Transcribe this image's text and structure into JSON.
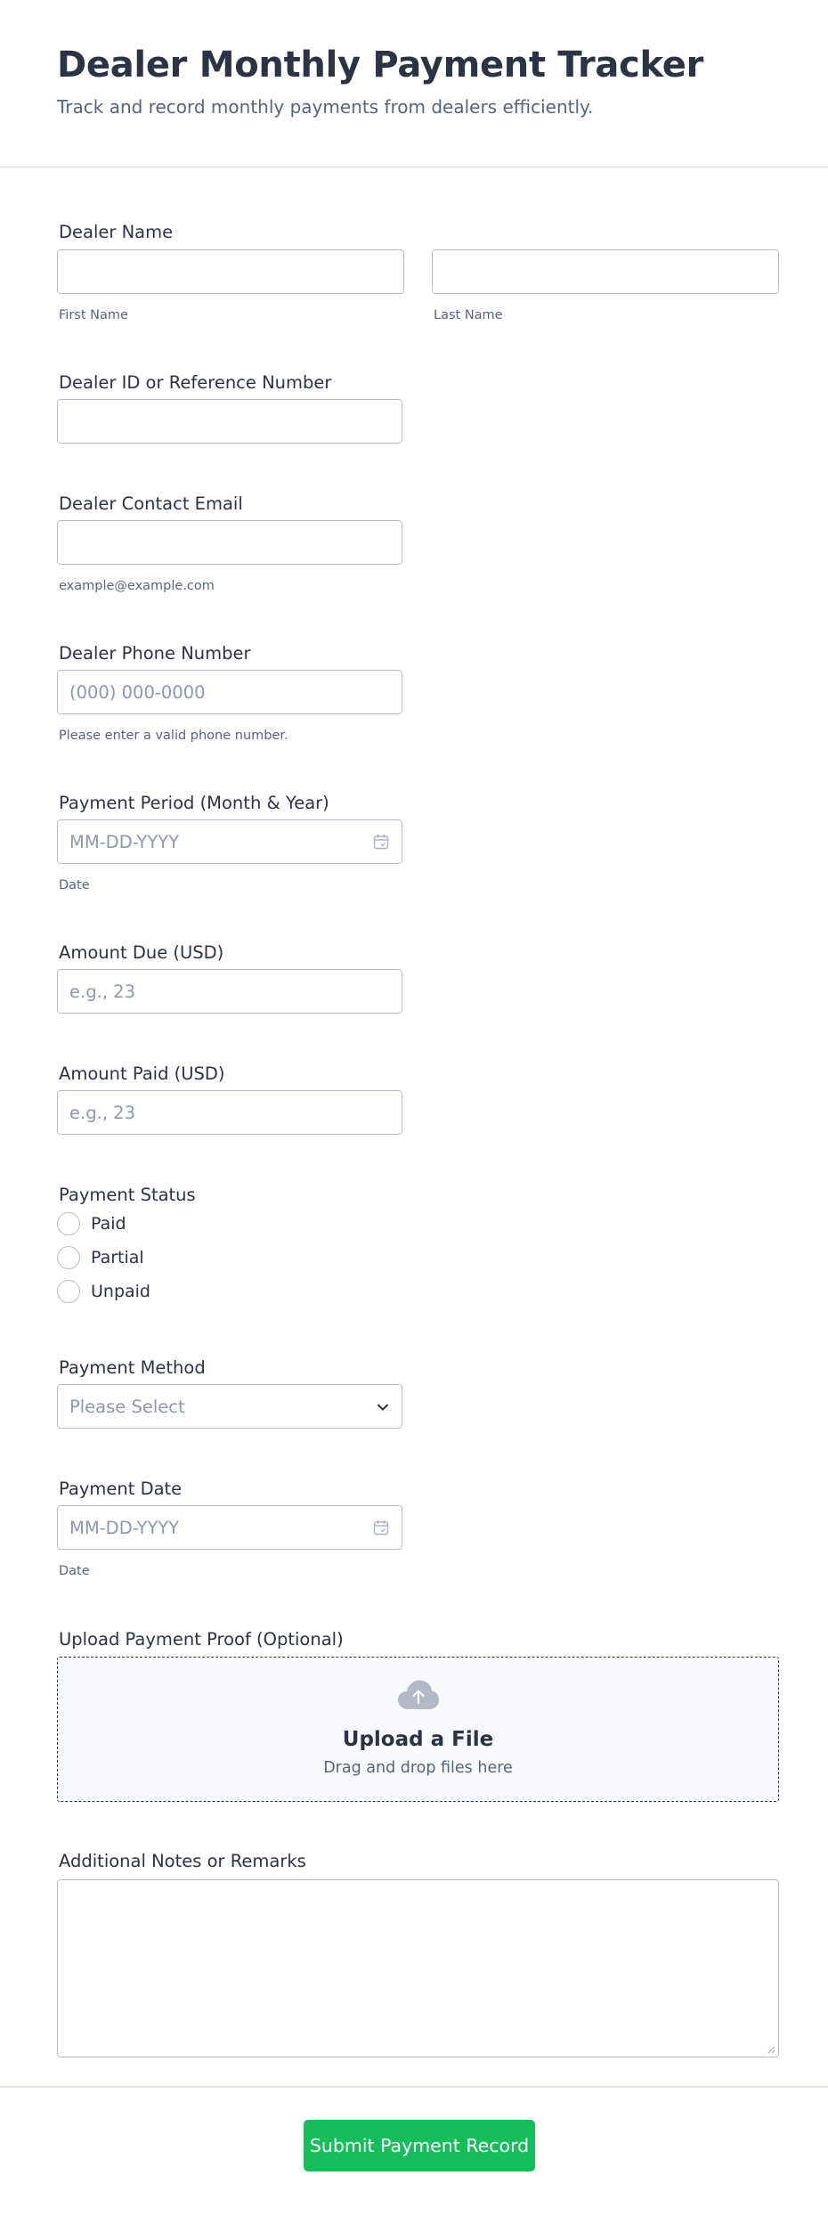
{
  "header": {
    "title": "Dealer Monthly Payment Tracker",
    "subtitle": "Track and record monthly payments from dealers efficiently."
  },
  "dealer_name": {
    "label": "Dealer Name",
    "first_sublabel": "First Name",
    "last_sublabel": "Last Name"
  },
  "dealer_id": {
    "label": "Dealer ID or Reference Number"
  },
  "email": {
    "label": "Dealer Contact Email",
    "sublabel": "example@example.com"
  },
  "phone": {
    "label": "Dealer Phone Number",
    "placeholder": "(000) 000-0000",
    "sublabel": "Please enter a valid phone number."
  },
  "payment_period": {
    "label": "Payment Period (Month & Year)",
    "placeholder": "MM-DD-YYYY",
    "sublabel": "Date",
    "icon": "calendar-icon"
  },
  "amount_due": {
    "label": "Amount Due (USD)",
    "placeholder": "e.g., 23"
  },
  "amount_paid": {
    "label": "Amount Paid (USD)",
    "placeholder": "e.g., 23"
  },
  "payment_status": {
    "label": "Payment Status",
    "options": [
      "Paid",
      "Partial",
      "Unpaid"
    ]
  },
  "payment_method": {
    "label": "Payment Method",
    "selected": "Please Select",
    "icon": "chevron-down-icon"
  },
  "payment_date": {
    "label": "Payment Date",
    "placeholder": "MM-DD-YYYY",
    "sublabel": "Date",
    "icon": "calendar-icon"
  },
  "upload": {
    "label": "Upload Payment Proof (Optional)",
    "title": "Upload a File",
    "subtitle": "Drag and drop files here",
    "icon": "cloud-upload-icon"
  },
  "notes": {
    "label": "Additional Notes or Remarks"
  },
  "submit": {
    "label": "Submit Payment Record"
  },
  "colors": {
    "accent": "#18bd5b",
    "text": "#2c3345",
    "muted": "#57647e",
    "border": "#b8bdc9"
  }
}
